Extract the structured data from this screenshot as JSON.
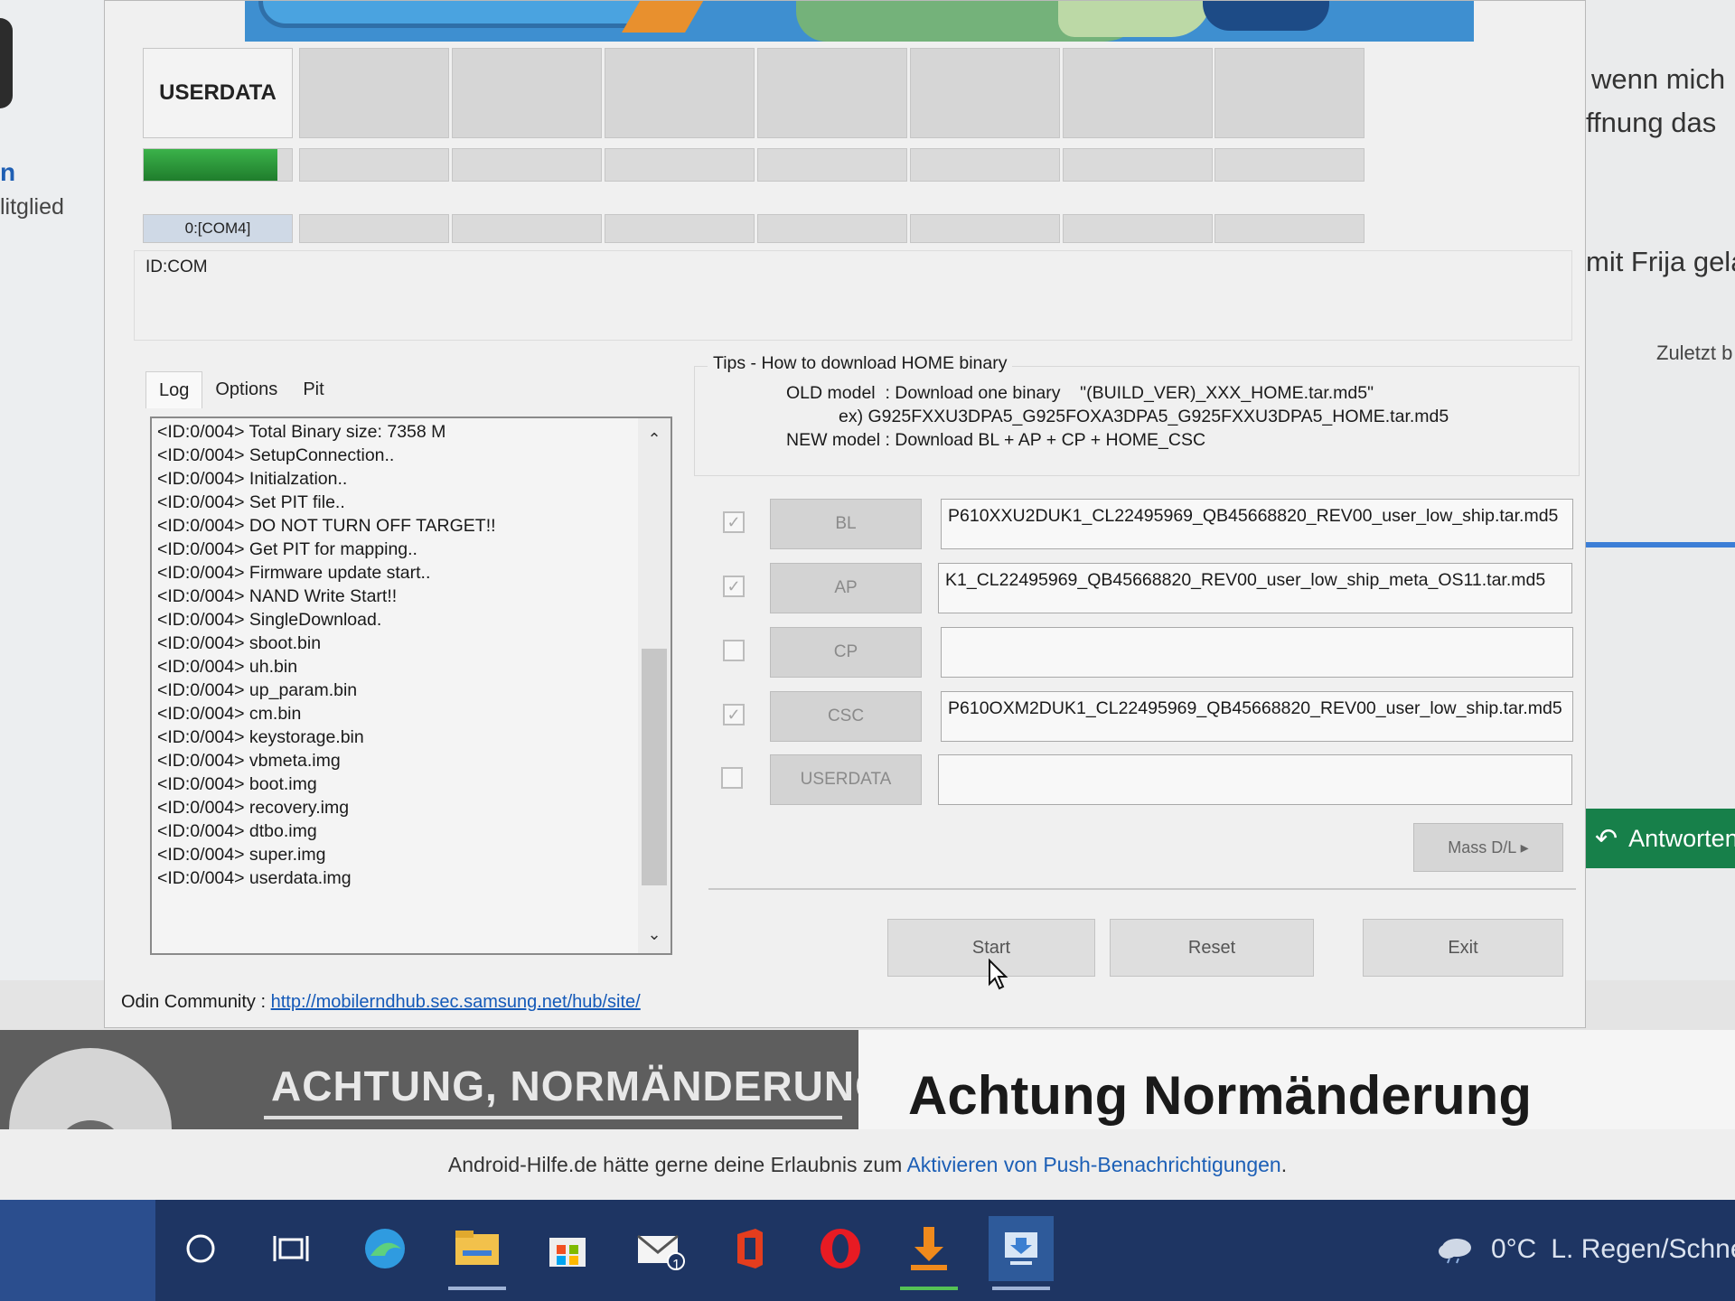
{
  "background_page": {
    "left_link": "n",
    "left_sub": "litglied",
    "right_lines": [
      "wenn mich",
      "ffnung das",
      "mit Frija gela",
      "Zuletzt b"
    ],
    "answer_button": "Antworten",
    "banner_left_text": "ACHTUNG, NORMÄNDERUNG!",
    "banner_right_text": "Achtung Normänderung",
    "notice_prefix": "Android-Hilfe.de hätte gerne deine Erlaubnis zum ",
    "notice_link": "Aktivieren von Push-Benachrichtigungen",
    "notice_suffix": "."
  },
  "odin": {
    "slots": {
      "active_label": "USERDATA",
      "progress": 0.9,
      "port_label": "0:[COM4]",
      "id_com": "ID:COM"
    },
    "tabs": [
      "Log",
      "Options",
      "Pit"
    ],
    "log_lines": [
      "<ID:0/004> Total Binary size: 7358 M",
      "<ID:0/004> SetupConnection..",
      "<ID:0/004> Initialzation..",
      "<ID:0/004> Set PIT file..",
      "<ID:0/004> DO NOT TURN OFF TARGET!!",
      "<ID:0/004> Get PIT for mapping..",
      "<ID:0/004> Firmware update start..",
      "<ID:0/004> NAND Write Start!!",
      "<ID:0/004> SingleDownload.",
      "<ID:0/004> sboot.bin",
      "<ID:0/004> uh.bin",
      "<ID:0/004> up_param.bin",
      "<ID:0/004> cm.bin",
      "<ID:0/004> keystorage.bin",
      "<ID:0/004> vbmeta.img",
      "<ID:0/004> boot.img",
      "<ID:0/004> recovery.img",
      "<ID:0/004> dtbo.img",
      "<ID:0/004> super.img",
      "<ID:0/004> userdata.img"
    ],
    "tips": {
      "title": "Tips - How to download HOME binary",
      "line1": "OLD model  : Download one binary    \"(BUILD_VER)_XXX_HOME.tar.md5\"",
      "line2": "ex) G925FXXU3DPA5_G925FOXA3DPA5_G925FXXU3DPA5_HOME.tar.md5",
      "line3": "NEW model : Download BL + AP + CP + HOME_CSC"
    },
    "files": [
      {
        "label": "BL",
        "checked": true,
        "value": "P610XXU2DUK1_CL22495969_QB45668820_REV00_user_low_ship.tar.md5"
      },
      {
        "label": "AP",
        "checked": true,
        "value": "K1_CL22495969_QB45668820_REV00_user_low_ship_meta_OS11.tar.md5"
      },
      {
        "label": "CP",
        "checked": false,
        "value": ""
      },
      {
        "label": "CSC",
        "checked": true,
        "value": "P610OXM2DUK1_CL22495969_QB45668820_REV00_user_low_ship.tar.md5"
      },
      {
        "label": "USERDATA",
        "checked": false,
        "value": ""
      }
    ],
    "mass_dl": "Mass D/L ▸",
    "buttons": {
      "start": "Start",
      "reset": "Reset",
      "exit": "Exit"
    },
    "community_label": "Odin Community : ",
    "community_link": "http://mobilerndhub.sec.samsung.net/hub/site/"
  },
  "taskbar": {
    "icons": [
      "search-circle-icon",
      "task-view-icon",
      "edge-icon",
      "file-explorer-icon",
      "store-icon",
      "mail-icon",
      "office-icon",
      "opera-icon",
      "download-icon",
      "odin-icon"
    ],
    "mail_badge": "1",
    "weather_temp": "0°C",
    "weather_desc": "L. Regen/Schnee"
  },
  "colors": {
    "progress_green": "#2a9a3a",
    "taskbar": "#1e3563",
    "link_blue": "#1459b8",
    "answer_green": "#17804a"
  }
}
